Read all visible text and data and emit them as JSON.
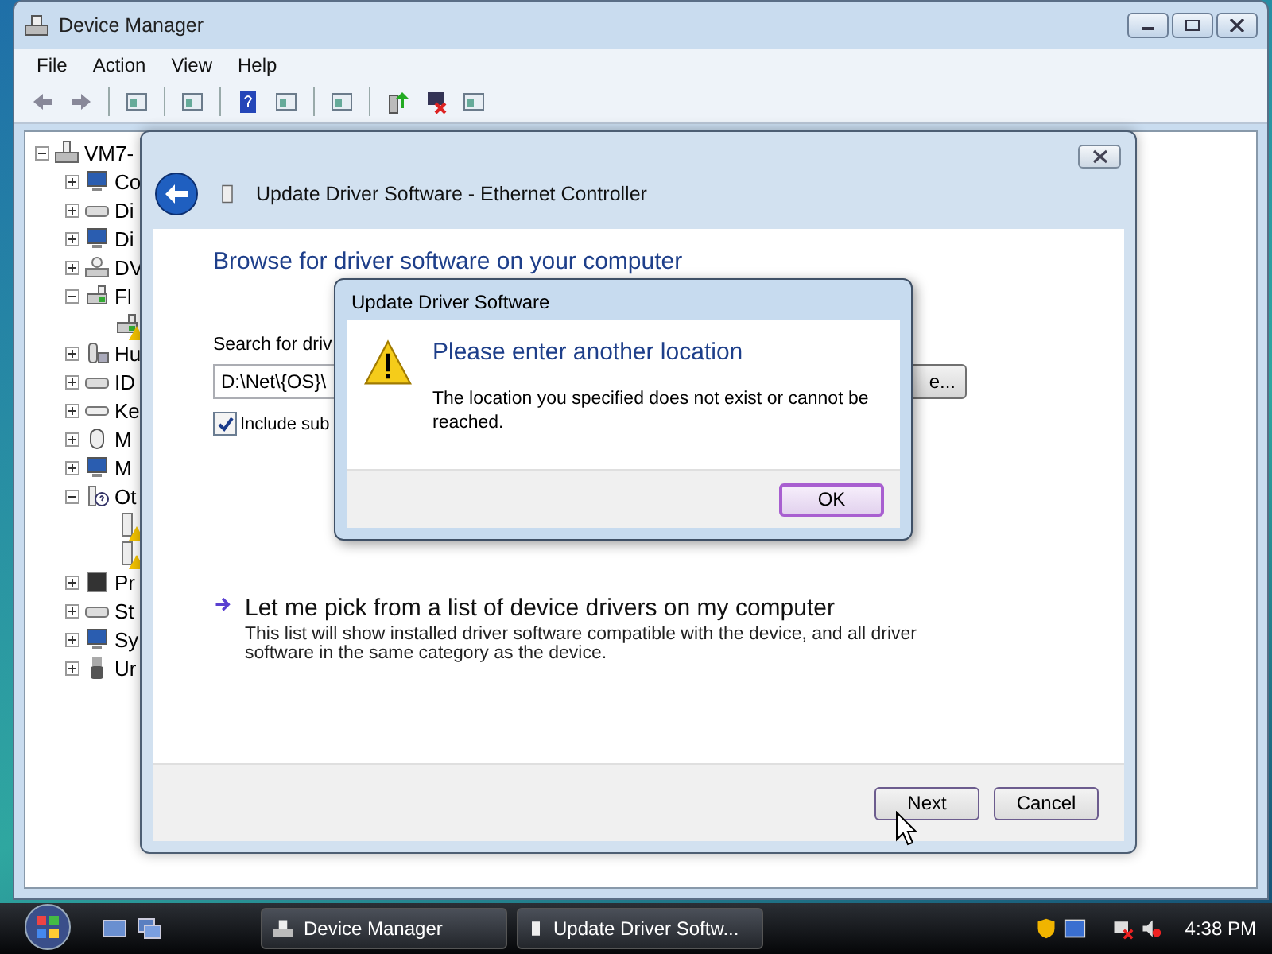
{
  "device_manager": {
    "title": "Device Manager",
    "menu": [
      "File",
      "Action",
      "View",
      "Help"
    ],
    "tree": {
      "label": "VM7-",
      "expanded": true,
      "children": [
        {
          "label": "Co",
          "kind": "computer",
          "expanded": false
        },
        {
          "label": "Di",
          "kind": "disk",
          "expanded": false
        },
        {
          "label": "Di",
          "kind": "display",
          "expanded": false
        },
        {
          "label": "DV",
          "kind": "dvd",
          "expanded": false
        },
        {
          "label": "Fl",
          "kind": "network",
          "expanded": true,
          "children": [
            {
              "kind": "network",
              "warning": true
            }
          ]
        },
        {
          "label": "Hu",
          "kind": "hid",
          "expanded": false
        },
        {
          "label": "ID",
          "kind": "disk",
          "expanded": false
        },
        {
          "label": "Ke",
          "kind": "keyboard",
          "expanded": false
        },
        {
          "label": "M",
          "kind": "mouse",
          "expanded": false
        },
        {
          "label": "M",
          "kind": "display",
          "expanded": false
        },
        {
          "label": "Ot",
          "kind": "other",
          "expanded": true,
          "children": [
            {
              "kind": "device",
              "warning": true
            },
            {
              "kind": "device",
              "warning": true
            }
          ]
        },
        {
          "label": "Pr",
          "kind": "chip",
          "expanded": false
        },
        {
          "label": "St",
          "kind": "storage",
          "expanded": false
        },
        {
          "label": "Sy",
          "kind": "computer",
          "expanded": false
        },
        {
          "label": "Ur",
          "kind": "usb",
          "expanded": false
        }
      ]
    }
  },
  "wizard": {
    "title": "Update Driver Software - Ethernet Controller",
    "heading": "Browse for driver software on your computer",
    "search_label": "Search for driv",
    "path": "D:\\Net\\{OS}\\",
    "browse_button": "e...",
    "include_subfolders": {
      "label": "Include sub",
      "checked": true
    },
    "pick_option": {
      "title": "Let me pick from a list of device drivers on my computer",
      "description": "This list will show installed driver software compatible with the device, and all driver software in the same category as the device."
    },
    "buttons": [
      "Next",
      "Cancel"
    ]
  },
  "dialog": {
    "title": "Update Driver Software",
    "heading": "Please enter another location",
    "message": "The location you specified does not exist or cannot be reached.",
    "button": "OK"
  },
  "taskbar": {
    "tasks": [
      "Device Manager",
      "Update Driver Softw..."
    ],
    "clock": "4:38 PM"
  }
}
